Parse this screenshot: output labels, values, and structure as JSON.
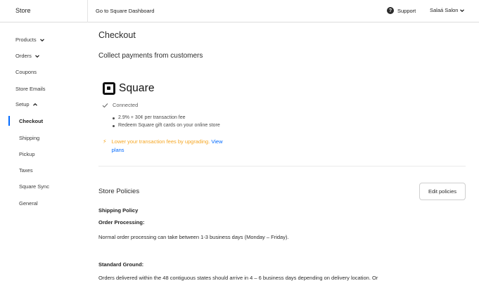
{
  "topbar": {
    "store_title": "Store",
    "dashboard_link": "Go to Square Dashboard",
    "support_label": "Support",
    "account_label": "Salaá Salon"
  },
  "sidebar": {
    "items": [
      {
        "label": "Products"
      },
      {
        "label": "Orders"
      },
      {
        "label": "Coupons"
      },
      {
        "label": "Store Emails"
      },
      {
        "label": "Setup"
      },
      {
        "label": "Checkout"
      },
      {
        "label": "Shipping"
      },
      {
        "label": "Pickup"
      },
      {
        "label": "Taxes"
      },
      {
        "label": "Square Sync"
      },
      {
        "label": "General"
      }
    ]
  },
  "main": {
    "page_title": "Checkout",
    "section_title": "Collect payments from customers",
    "provider": {
      "name": "Square",
      "status": "Connected",
      "details": [
        "2.9% + 30¢ per transaction fee",
        "Redeem Square gift cards on your online store"
      ]
    },
    "upgrade": {
      "text": "Lower your transaction fees by upgrading.",
      "link_line1": "View",
      "link_line2": "plans"
    },
    "policies": {
      "title": "Store Policies",
      "edit_button": "Edit policies",
      "shipping_policy": "Shipping Policy",
      "order_processing_heading": "Order Processing:",
      "order_processing_text": "Normal order processing can take between 1-3 business days (Monday – Friday).",
      "standard_ground_heading": "Standard Ground:",
      "standard_ground_text": "Orders delivered within the 48 contiguous states should arrive in 4 – 6 business days depending on delivery location. Or"
    }
  },
  "colors": {
    "accent": "#006aff",
    "warning": "#f5a623"
  }
}
